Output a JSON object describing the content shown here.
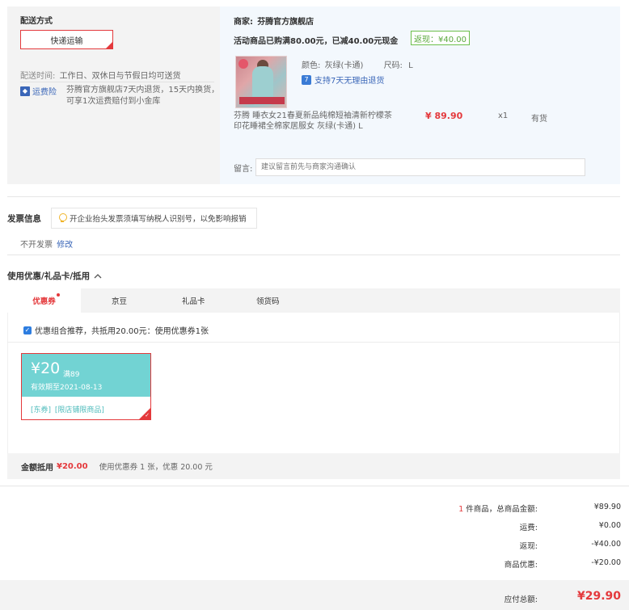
{
  "shipping": {
    "title": "配送方式",
    "method": "快递运输",
    "time_label": "配送时间:",
    "time_value": "工作日、双休日与节假日均可送货",
    "insurance_label": "运费险",
    "insurance_desc_line1": "芬腾官方旗舰店7天内退货，15天内换货，",
    "insurance_desc_line2": "可享1次运费赔付到小金库"
  },
  "merchant": {
    "label": "商家:",
    "name": "芬腾官方旗舰店",
    "promo": "活动商品已购满80.00元，已减40.00元现金",
    "cashback_badge": "返现：¥40.00"
  },
  "product": {
    "color_label": "颜色:",
    "color_value": "灰绿(卡通)",
    "size_label": "尺码:",
    "size_value": "L",
    "return_policy": "支持7天无理由退货",
    "name_line1": "芬腾 睡衣女21春夏新品纯棉短袖清新柠檬茶",
    "name_line2": "印花睡裙全棉家居服女 灰绿(卡通)   L",
    "price": "¥ 89.90",
    "qty": "x1",
    "stock": "有货"
  },
  "remark": {
    "label": "留言:",
    "placeholder": "建议留言前先与商家沟通确认"
  },
  "invoice": {
    "title": "发票信息",
    "tip": "开企业抬头发票须填写纳税人识别号，以免影响报销",
    "value": "不开发票",
    "edit": "修改"
  },
  "discount": {
    "title": "使用优惠/礼品卡/抵用",
    "tabs": [
      "优惠券",
      "京豆",
      "礼品卡",
      "领货码"
    ],
    "recommend": "优惠组合推荐，共抵用20.00元：使用优惠券1张",
    "coupon": {
      "amount": "¥20",
      "condition": "满89",
      "expiry": "有效期至2021-08-13",
      "tag1": "[东券]",
      "tag2": "[限店铺限商品]"
    },
    "summary_label": "金额抵用",
    "summary_amount": "¥20.00",
    "summary_desc": "使用优惠券 1 张，优惠 20.00 元"
  },
  "totals": {
    "count": "1",
    "count_suffix": "件商品，总商品金额:",
    "goods_total": "¥89.90",
    "shipping_label": "运费:",
    "shipping_value": "¥0.00",
    "cashback_label": "返现:",
    "cashback_value": "-¥40.00",
    "discount_label": "商品优惠:",
    "discount_value": "-¥20.00",
    "payable_label": "应付总额:",
    "payable_value": "¥29.90"
  },
  "colors": {
    "accent": "#e4393c",
    "coupon": "#72d3d3",
    "link": "#3a66b8",
    "cashback": "#5aa83d"
  }
}
